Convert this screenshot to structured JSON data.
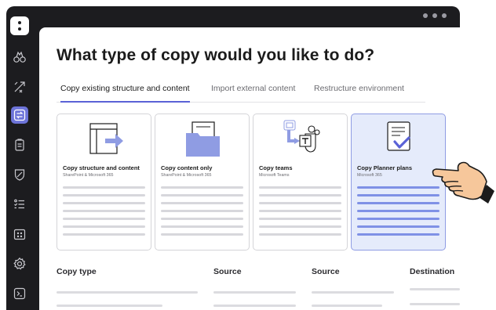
{
  "app": {
    "logo_icon": "app-logo-icon",
    "window_controls": [
      "dot",
      "dot",
      "dot"
    ]
  },
  "sidebar": {
    "items": [
      {
        "name": "binoculars-icon",
        "active": false
      },
      {
        "name": "transfer-arrows-icon",
        "active": false
      },
      {
        "name": "copy-swap-icon",
        "active": true
      },
      {
        "name": "clipboard-icon",
        "active": false
      },
      {
        "name": "shield-icon",
        "active": false
      },
      {
        "name": "list-check-icon",
        "active": false
      },
      {
        "name": "calendar-icon",
        "active": false
      },
      {
        "name": "gear-icon",
        "active": false
      },
      {
        "name": "terminal-icon",
        "active": false
      }
    ]
  },
  "page": {
    "title": "What type of copy would you like to do?"
  },
  "tabs": [
    {
      "label": "Copy existing structure and content",
      "active": true
    },
    {
      "label": "Import external content",
      "active": false
    },
    {
      "label": "Restructure environment",
      "active": false
    }
  ],
  "cards": [
    {
      "title": "Copy structure and content",
      "subtitle": "SharePoint & Microsoft 365",
      "icon": "window-arrow-icon",
      "selected": false
    },
    {
      "title": "Copy content only",
      "subtitle": "SharePoint & Microsoft 365",
      "icon": "folder-icon",
      "selected": false
    },
    {
      "title": "Copy teams",
      "subtitle": "Microsoft Teams",
      "icon": "teams-icon",
      "selected": false
    },
    {
      "title": "Copy Planner plans",
      "subtitle": "Microsoft 365",
      "icon": "planner-check-icon",
      "selected": true
    }
  ],
  "table": {
    "headers": [
      "Copy type",
      "Source",
      "Source",
      "Destination"
    ]
  },
  "overlay": {
    "icon": "pointing-hand-icon"
  },
  "colors": {
    "accent": "#5a62d6",
    "sidebar": "#1c1c1f",
    "selected_card": "#e5ebfb",
    "card_art": "#8f9ce3"
  }
}
